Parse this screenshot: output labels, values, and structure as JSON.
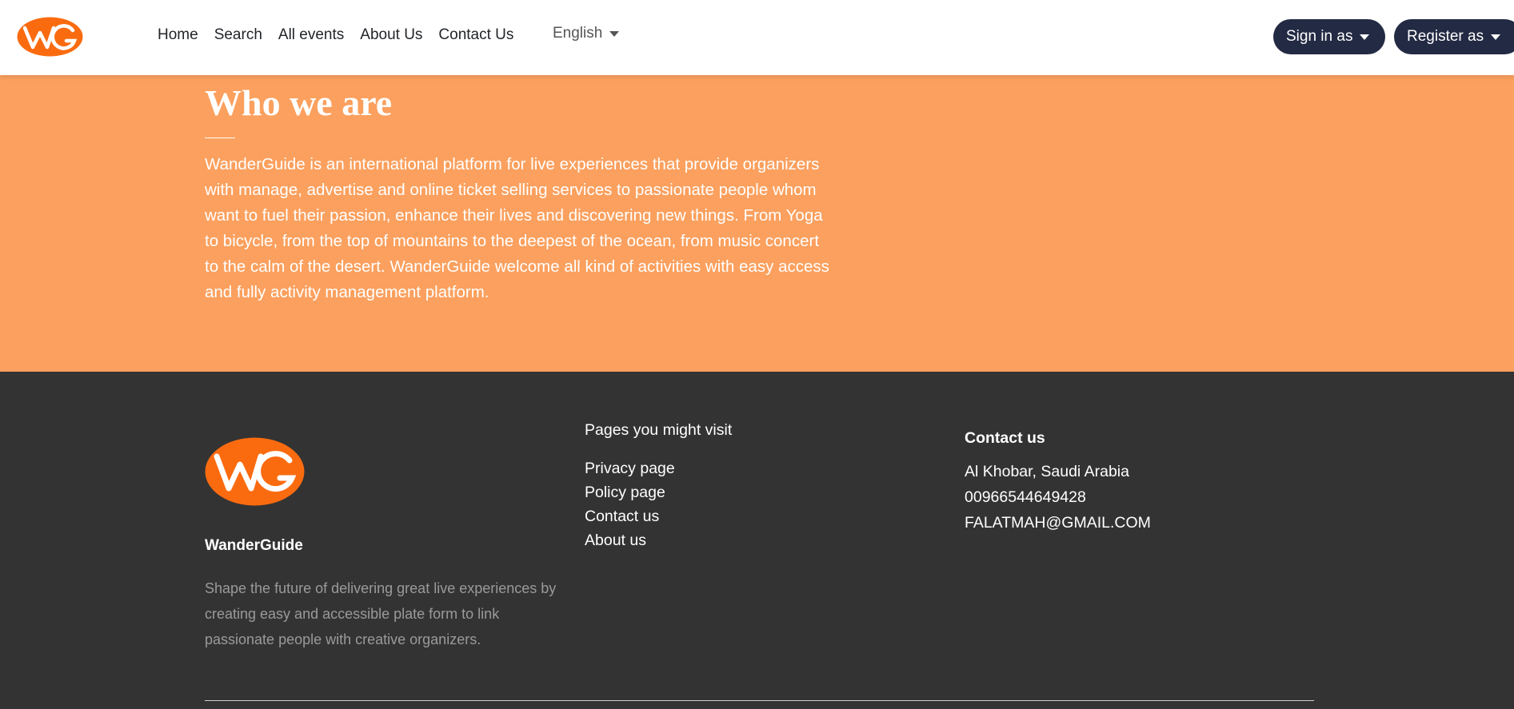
{
  "nav": {
    "links": [
      "Home",
      "Search",
      "All events",
      "About Us",
      "Contact Us"
    ],
    "language": "English",
    "sign_in": "Sign in as",
    "register": "Register as"
  },
  "about": {
    "title": "Who we are",
    "text": "WanderGuide is an international platform for live experiences that provide organizers with manage, advertise and online ticket selling services to passionate people whom want to fuel their passion, enhance their lives and discovering new things. From Yoga to bicycle, from the top of mountains to the deepest of the ocean, from music concert to the calm of the desert. WanderGuide welcome all kind of activities with easy access and fully activity management platform."
  },
  "footer": {
    "brand": "WanderGuide",
    "description": "Shape the future of delivering great live experiences by creating easy and accessible plate form to link passionate people with creative organizers.",
    "pages_heading": "Pages you might visit",
    "pages": [
      "Privacy page",
      "Policy page",
      "Contact us",
      "About us"
    ],
    "contact_heading": "Contact us",
    "contact": {
      "address": "Al Khobar, Saudi Arabia",
      "phone": "00966544649428",
      "email": "FALATMAH@GMAIL.COM"
    }
  },
  "colors": {
    "brand_orange": "#fa6b10",
    "hero_bg": "#fba05e",
    "footer_bg": "#333333",
    "button_dark": "#232a43"
  },
  "icons": {
    "logo": "wanderguide-logo",
    "caret": "caret-down-icon"
  }
}
